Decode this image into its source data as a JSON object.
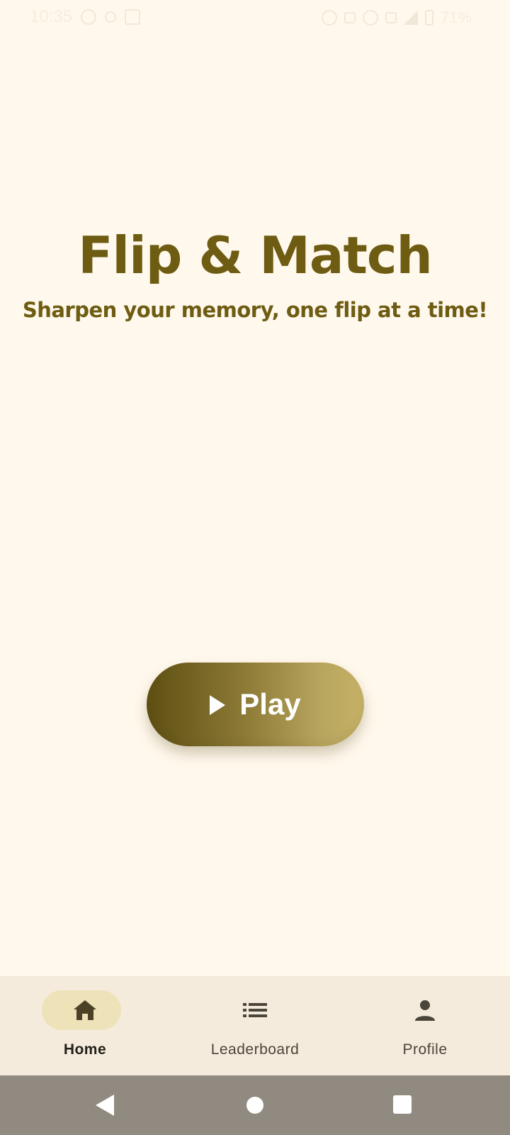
{
  "status_bar": {
    "time": "10:35",
    "battery": "71%"
  },
  "home": {
    "title": "Flip & Match",
    "subtitle": "Sharpen your memory, one flip at a time!"
  },
  "play_button": {
    "label": "Play",
    "icon": "play-icon"
  },
  "bottom_nav": {
    "active": "Home",
    "items": [
      {
        "label": "Home",
        "icon": "home-icon"
      },
      {
        "label": "Leaderboard",
        "icon": "list-icon"
      },
      {
        "label": "Profile",
        "icon": "person-icon"
      }
    ]
  },
  "system_nav": {
    "buttons": [
      "back-icon",
      "home-circle-icon",
      "recents-square-icon"
    ]
  },
  "colors": {
    "background": "#FFF8EC",
    "title": "#6E5C12",
    "nav_background": "#F4EBDD",
    "active_pill": "#EEE2B9",
    "system_nav": "#908A80"
  }
}
